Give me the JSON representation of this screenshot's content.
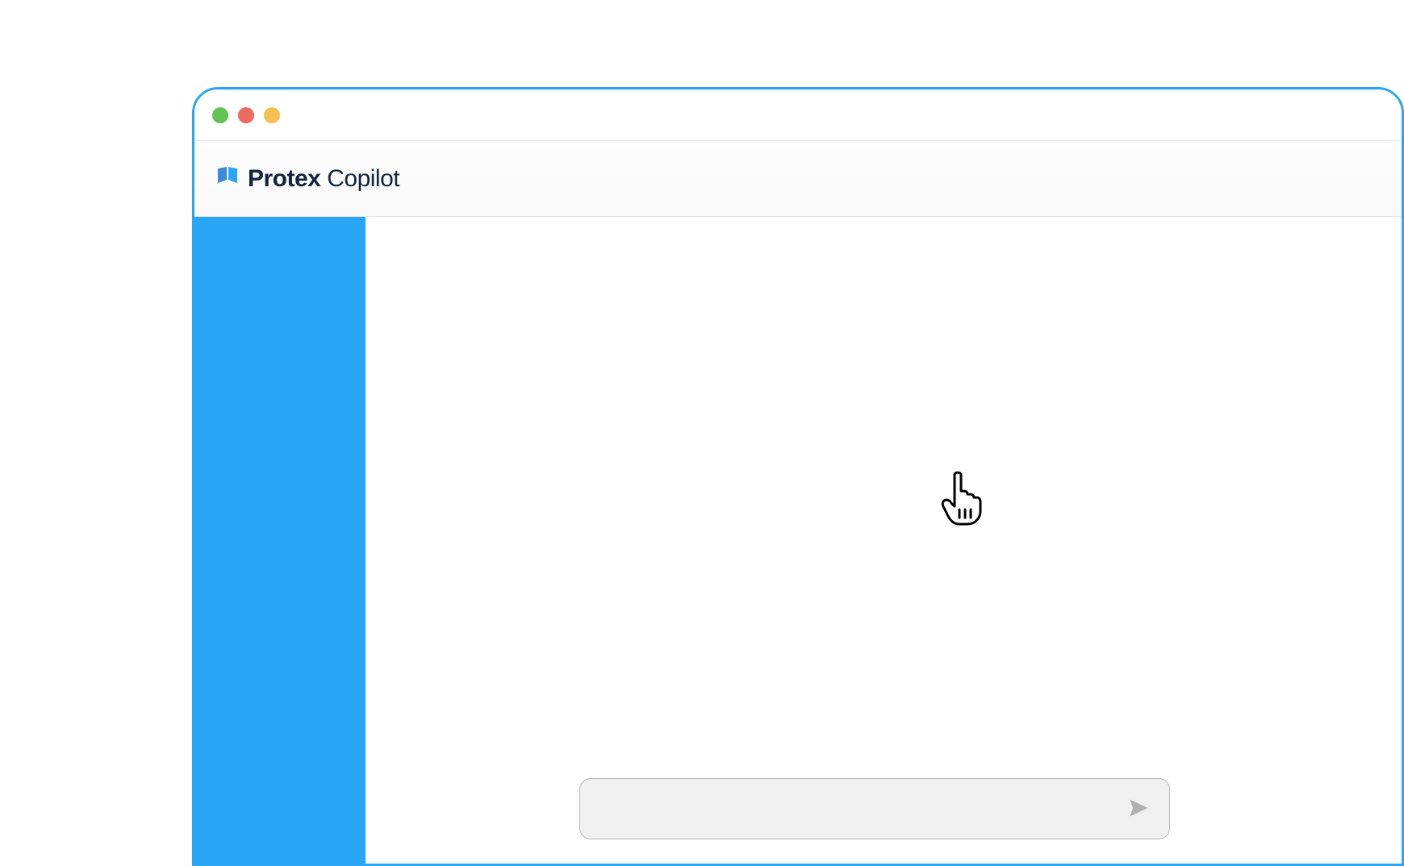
{
  "window": {
    "traffic_lights": [
      "close",
      "minimize",
      "maximize"
    ]
  },
  "header": {
    "brand_bold": "Protex",
    "brand_light": "Copilot",
    "logo_name": "protex-shield-logo"
  },
  "sidebar": {
    "items": []
  },
  "main": {
    "cursor_name": "pointer-hand-cursor"
  },
  "input": {
    "value": "",
    "placeholder": "",
    "send_icon": "send-icon"
  },
  "colors": {
    "accent": "#28a6f5",
    "text_dark": "#12253d",
    "input_bg": "#f0f0f0",
    "input_border": "#b8b8b8"
  }
}
